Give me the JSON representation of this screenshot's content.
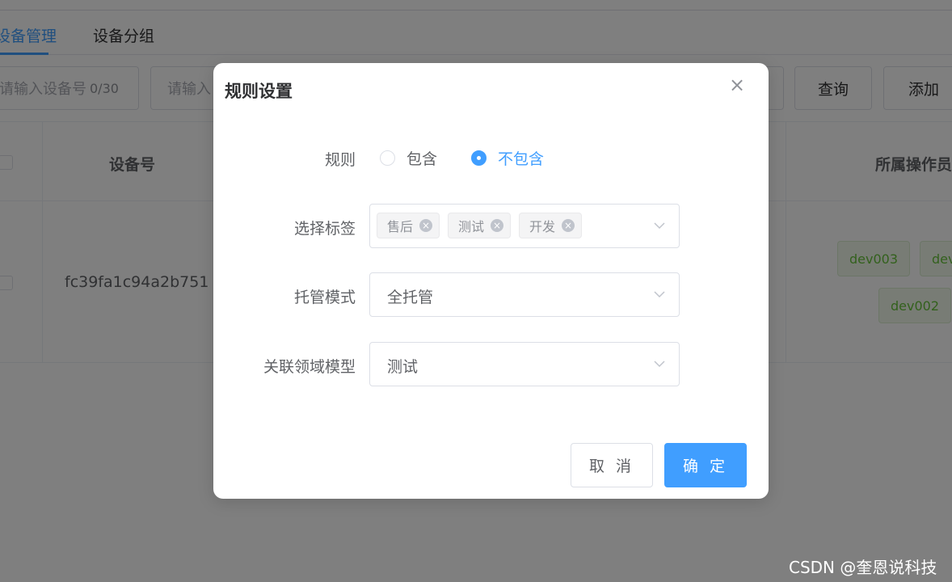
{
  "tabs": [
    {
      "label": "设备管理",
      "active": true
    },
    {
      "label": "设备分组",
      "active": false
    }
  ],
  "filters": {
    "device_no_placeholder": "请输入设备号",
    "device_no_count": "0/30",
    "second_placeholder": "请输入"
  },
  "toolbar": {
    "query_label": "查询",
    "add_label": "添加"
  },
  "table": {
    "columns": {
      "device_no": "设备号",
      "operators": "所属操作员"
    },
    "rows": [
      {
        "device_no": "fc39fa1c94a2b751",
        "operators": [
          "dev003",
          "dev",
          "dev002"
        ]
      }
    ]
  },
  "dialog": {
    "title": "规则设置",
    "rule_label": "规则",
    "rule_options": [
      "包含",
      "不包含"
    ],
    "rule_selected": "不包含",
    "tags_label": "选择标签",
    "tags": [
      "售后",
      "测试",
      "开发"
    ],
    "mode_label": "托管模式",
    "mode_value": "全托管",
    "domain_label": "关联领域模型",
    "domain_value": "测试",
    "cancel_label": "取 消",
    "ok_label": "确 定"
  },
  "watermark": "CSDN @奎恩说科技",
  "colors": {
    "primary": "#409eff",
    "success_tag": "#67c23a"
  }
}
